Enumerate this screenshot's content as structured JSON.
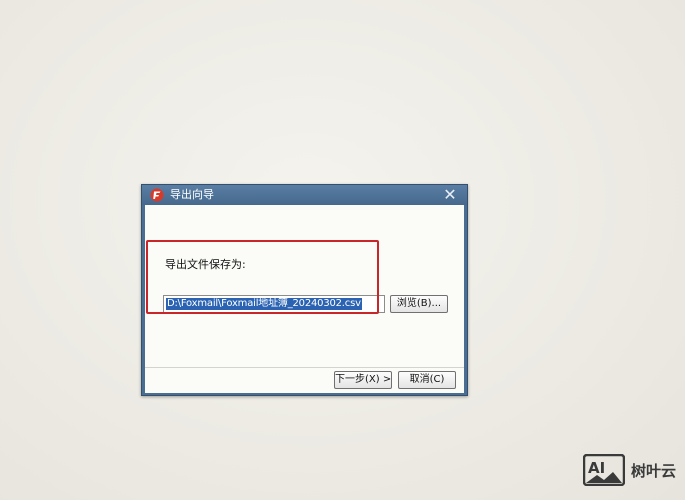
{
  "dialog": {
    "title": "导出向导",
    "close_glyph": "✕",
    "app_icon": "foxmail-logo-icon",
    "save_label": "导出文件保存为:",
    "path_value": "D:\\Foxmail\\Foxmail地址簿_20240302.csv",
    "browse_label": "浏览(B)...",
    "next_label": "下一步(X) >",
    "cancel_label": "取消(C)"
  },
  "annotation": {
    "highlight_color": "#c9262a"
  },
  "colors": {
    "titlebar": "#4a6d92",
    "selection": "#2b63b2",
    "client_bg": "#fbfbf7"
  },
  "watermark": {
    "logo": "AI",
    "text": "树叶云"
  }
}
